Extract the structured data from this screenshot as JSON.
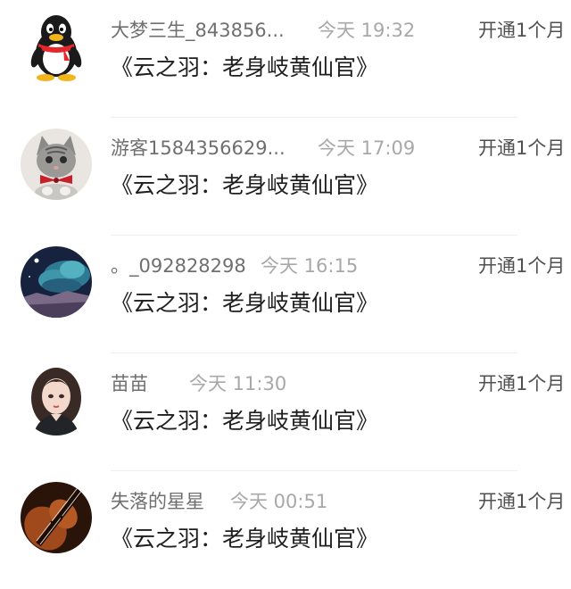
{
  "records": [
    {
      "avatar": "qq-penguin-avatar",
      "name": "大梦三生_843856...",
      "time": "今天 19:32",
      "action": "开通1个月",
      "message": "《云之羽：老身岐黄仙官》"
    },
    {
      "avatar": "kitten-avatar",
      "name": "游客1584356629...",
      "time": "今天 17:09",
      "action": "开通1个月",
      "message": "《云之羽：老身岐黄仙官》"
    },
    {
      "avatar": "night-sky-avatar",
      "name": "。_092828298",
      "time": "今天 16:15",
      "action": "开通1个月",
      "message": "《云之羽：老身岐黄仙官》"
    },
    {
      "avatar": "girl-portrait-avatar",
      "name": "苗苗",
      "time": "今天 11:30",
      "action": "开通1个月",
      "message": "《云之羽：老身岐黄仙官》"
    },
    {
      "avatar": "violin-avatar",
      "name": "失落的星星",
      "time": "今天 00:51",
      "action": "开通1个月",
      "message": "《云之羽：老身岐黄仙官》"
    }
  ]
}
